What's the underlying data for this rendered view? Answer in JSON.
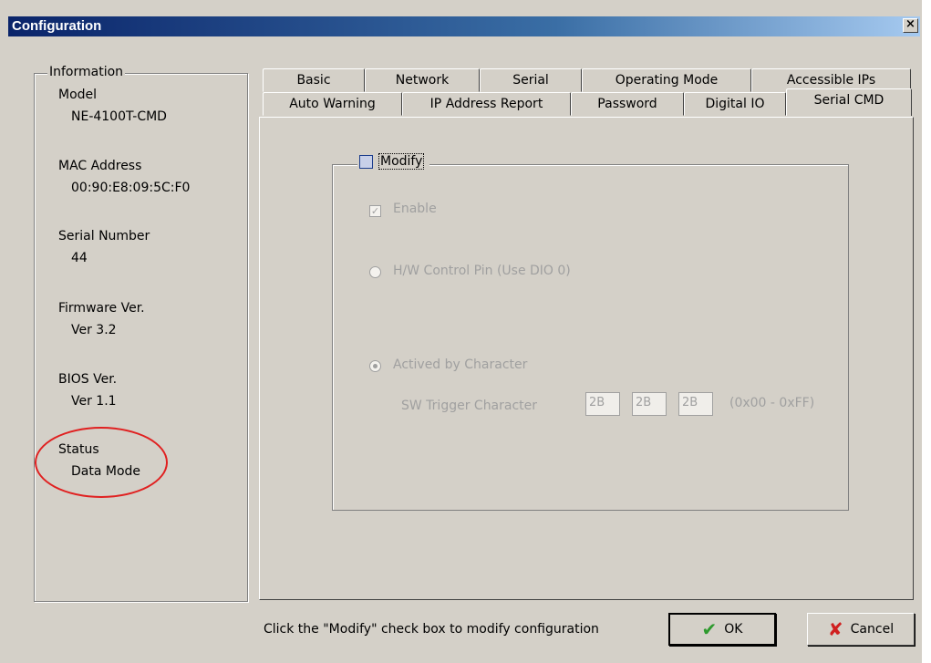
{
  "window": {
    "title": "Configuration",
    "close_label": "×"
  },
  "info": {
    "legend": "Information",
    "model_label": "Model",
    "model_value": "NE-4100T-CMD",
    "mac_label": "MAC Address",
    "mac_value": "00:90:E8:09:5C:F0",
    "serial_label": "Serial Number",
    "serial_value": "44",
    "firmware_label": "Firmware Ver.",
    "firmware_value": "Ver 3.2",
    "bios_label": "BIOS Ver.",
    "bios_value": "Ver 1.1",
    "status_label": "Status",
    "status_value": "Data Mode"
  },
  "tabs": {
    "row1": [
      "Basic",
      "Network",
      "Serial",
      "Operating Mode",
      "Accessible IPs"
    ],
    "row2": [
      "Auto Warning",
      "IP Address Report",
      "Password",
      "Digital IO",
      "Serial CMD"
    ],
    "active": "Serial CMD"
  },
  "serial_cmd": {
    "modify_label": "Modify",
    "modify_checked": false,
    "enable_label": "Enable",
    "enable_checked": true,
    "hw_pin_label": "H/W Control Pin (Use DIO 0)",
    "actived_label": "Actived by Character",
    "sw_trigger_label": "SW Trigger Character",
    "trigger_chars": [
      "2B",
      "2B",
      "2B"
    ],
    "range_label": "(0x00 - 0xFF)"
  },
  "footer": {
    "hint": "Click the \"Modify\" check box to modify configuration",
    "ok_label": "OK",
    "cancel_label": "Cancel"
  },
  "colors": {
    "titlebar": "#0a246a",
    "face": "#d4d0c8",
    "status_circle": "#e02020"
  },
  "icons": {
    "ok": "check-icon",
    "cancel": "x-icon",
    "close": "close-icon"
  }
}
